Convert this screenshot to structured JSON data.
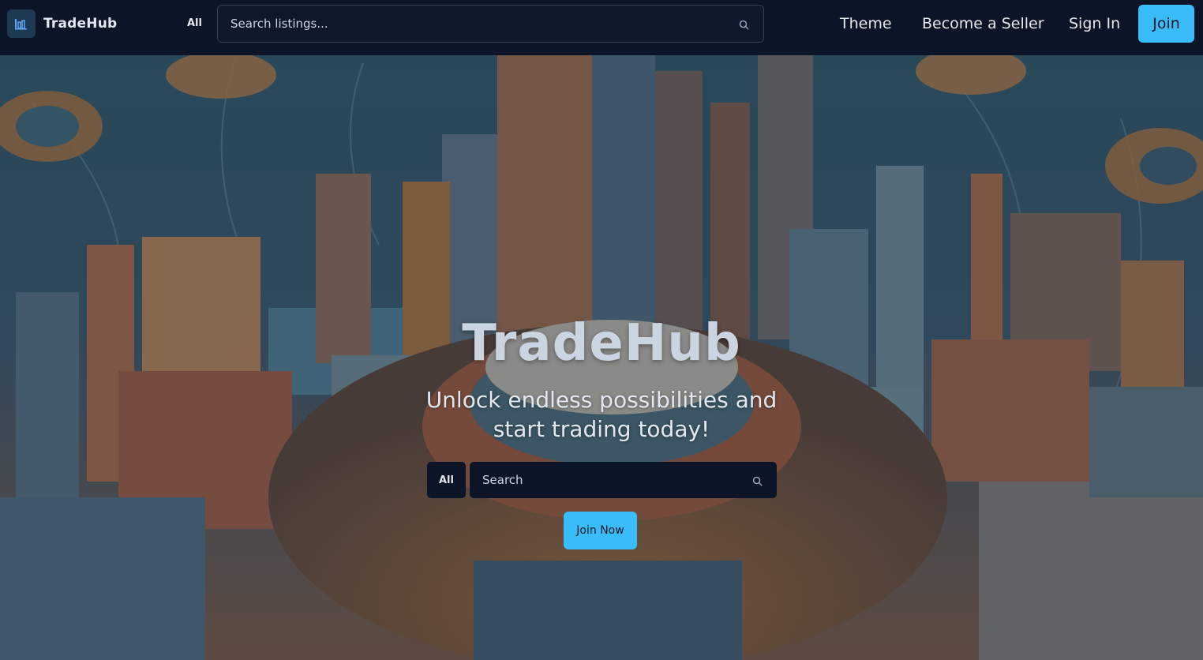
{
  "header": {
    "brand": "TradeHub",
    "category": "All",
    "search_placeholder": "Search listings...",
    "nav": {
      "theme": "Theme",
      "seller": "Become a Seller",
      "signin": "Sign In",
      "join": "Join"
    }
  },
  "hero": {
    "title": "TradeHub",
    "subtitle": "Unlock endless possibilities and start trading today!",
    "category": "All",
    "search_placeholder": "Search",
    "cta": "Join Now"
  },
  "colors": {
    "header_bg": "#0c1527",
    "accent": "#38bdf8",
    "text": "#e5e7eb"
  },
  "icons": {
    "logo": "chart-logo-icon",
    "search": "search-icon"
  }
}
